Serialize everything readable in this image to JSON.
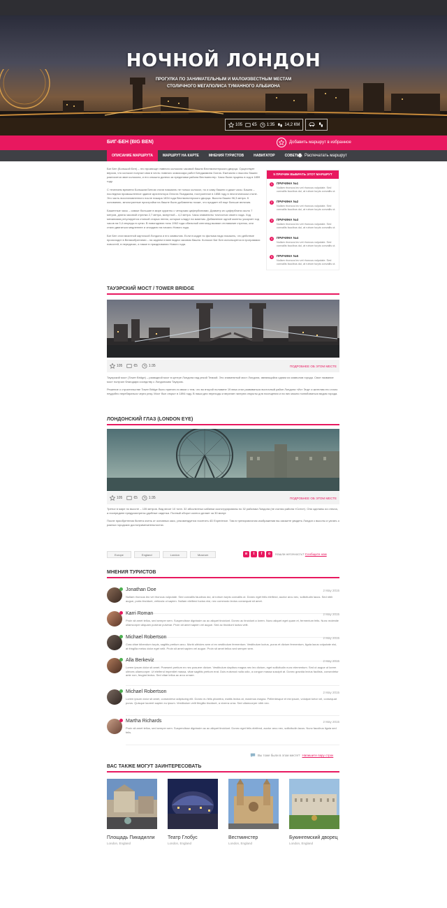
{
  "hero": {
    "title": "НОЧНОЙ ЛОНДОН",
    "subtitle_line1": "ПРОГУЛКА ПО ЗАНИМАТЕЛЬНЫМ И МАЛОИЗВЕСТНЫМ МЕСТАМ",
    "subtitle_line2": "СТОЛИЧНОГО МЕГАПОЛИСА ТУМАННОГО АЛЬБИОНА",
    "stats": {
      "likes": "105",
      "price": "€5",
      "time": "1:35",
      "distance": "14,2 КМ"
    },
    "transport_icons": [
      "car-icon",
      "walk-icon"
    ]
  },
  "place": {
    "title": "БИГ-БЕН (BIG BEN)",
    "fav_label": "Добавить маршрут в избранное"
  },
  "nav": {
    "tabs": [
      "ОПИСАНИЕ МАРШРУТА",
      "МАРШРУТ НА КАРТЕ",
      "МНЕНИЯ ТУРИСТОВ",
      "НАВИГАТОР",
      "СОВЕТЫ"
    ],
    "active_tab": 0,
    "print_label": "Распечатать маршрут"
  },
  "main_text": {
    "p1": "Биг Бен (Большой Бен) – это прозвище главного колокола часовой башни Вестминстерского дворца. Существует версия, что колокол получил имя в честь главного комиссара работ Бенджамина Холла. Ежечасно с высоты башни разносится звон колокола, и его слышно далеко за пределами района Вестминстер. Часы были пущены в ход в 1859 году.",
    "p2": "С течением времени Большим Беном стали называть не только колокол, но и саму башню и даже часы. Башня – последняя промышленное здание архитектора Огюста Пьюджина, построенное в 1858 году в неоготическом стиле. Это часть восстановленного после пожара 1834 года Вестминстерского дворца. Высота башни 96,3 метра. К основанию, многогранные пристройки на башне были добавлены позже, что придает ей еще больше величия.",
    "p3": "Башенные часы – самые большие в мире куранты с четырьмя циферблатами. Диаметр их циферблата около 7 метров, длина часовой стрелки 2,7 метра, минутной – 4,2 метра. Часы знамениты точностью своего хода. Ход механизма регулируется стопкой старых пенни, которые кладут на маятник. Добавление одной монеты ускоряет ход часов на 0,4 секунды в сутки. В новогоднюю ночь 1962 года обильный снегопад вызвал отставание стрелок, они стали двигаться медленнее и опоздали на начало Нового года.",
    "p4": "Биг Бен стал визитной карточкой Лондона и его символом. Если в кадре по фильма надо показать, что действие происходит в Великобритании – на заднем плане видна часовая башня. Колокол Биг Бен используется в программах новостей, в передачах, а также в праздновании Нового года."
  },
  "reasons": {
    "heading": "5 ПРИЧИН ВЫБРАТЬ ЭТОТ МАРШРУТ",
    "items": [
      {
        "num": "1",
        "title": "ПРИЧИНА №1",
        "text": "Nullam rhoncus leo vel rhoncus vulputate. Sed convallis faucibus dui, at rutrum turpis convallis ut."
      },
      {
        "num": "2",
        "title": "ПРИЧИНА №2",
        "text": "Nullam rhoncus leo vel rhoncus vulputate. Sed convallis faucibus dui, at rutrum turpis convallis ut."
      },
      {
        "num": "3",
        "title": "ПРИЧИНА №3",
        "text": "Nullam rhoncus leo vel rhoncus vulputate. Sed convallis faucibus dui, at rutrum turpis convallis ut."
      },
      {
        "num": "4",
        "title": "ПРИЧИНА №4",
        "text": "Nullam rhoncus leo vel rhoncus vulputate. Sed convallis faucibus dui, at rutrum turpis convallis ut."
      },
      {
        "num": "5",
        "title": "ПРИЧИНА №5",
        "text": "Nullam rhoncus leo vel rhoncus vulputate. Sed convallis faucibus dui, at rutrum turpis convallis ut."
      }
    ]
  },
  "tower_bridge": {
    "title": "ТАУЭРСКИЙ МОСТ / TOWER BRIDGE",
    "likes": "105",
    "price": "€5",
    "time": "1:35",
    "more_label": "ПОДРОБНЕЕ ОБ ЭТОМ МЕСТЕ",
    "p1": "Тауэрский мост (Tower Bridge) – разводной мост в центре Лондона над рекой Темзой. Это знаменитый мост Лондона, являющийся одним из символов города. Свое название мост получил благодаря соседству с Лондонским Тауэром.",
    "p2": "Решение о строительстве Tower Bridge было принято в связи с тем, что во второй половине 19 века стал развиваться восточный район Лондона «Ист Энд» и жителям его стало неудобно перебираться через реку. Мост был открыт в 1894 году. В наши дни переходы и верхние галереи открыты для посещения и на них можно полюбоваться видом города."
  },
  "london_eye": {
    "title": "ЛОНДОНСКИЙ ГЛАЗ (LONDON EYE)",
    "likes": "105",
    "price": "€5",
    "time": "1:35",
    "more_label": "ПОДРОБНЕЕ ОБ ЭТОМ МЕСТЕ",
    "p1": "Третье в мире по высоте – 135 метров. Вид весит 10 тонн. 32 абсолютных кабинки сконструированы по 32 районам Лондона (не считая района «Сити»). Они сделаны из стекла, а посередине предусмотрены удобные сиденья. Полный оборот колесо делает за 30 минут.",
    "p2": "После приобретения билета очень от основных касс, рекомендуется посетить 4D Experience. Там в тренировочном изображении вы сможете увидеть Лондон с высоты и узнать о разных городских достопримечательностях."
  },
  "tags": [
    "Europe",
    "England",
    "London",
    "Museum"
  ],
  "share_icons": [
    "vk-icon",
    "twitter-icon",
    "facebook-icon",
    "odnoklassniki-icon"
  ],
  "report": {
    "text": "Нашли неточность?",
    "link": "Сообщите нам"
  },
  "comments": {
    "title": "МНЕНИЯ ТУРИСТОВ",
    "items": [
      {
        "name": "Jonathan Doe",
        "date": "2 May 2015",
        "text": "Nullam rhoncus leo vel rhoncus vulputate. Sed convallis faucibus dui, at rutrum turpis convallis ut. Donec eget felis eleifend, auctor arcu nec, sollicitudin lacus. Sed nibh augue, porta tincidunt, vehicula ut sapien. Nullam eleifend luctus nisi, nec commodo lectus consequat sit amet."
      },
      {
        "name": "Karri Roman",
        "date": "2 May 2015",
        "text": "Proin sit amet tellus, sed semper sem. Suspendisse dignissim ac ac aliquet tincidunt. Donec ac tincidunt a lorem. Nunc aliquet eget quam et, fermentum felis. Nunc molestie ullamcorper aliquam pulvinar pulvinar. Proin sit amet sapien vel augue. Sed ac tincidunt luctus velit."
      },
      {
        "name": "Michael Robertson",
        "date": "2 May 2015",
        "text": "Cras vitae bibendum turpis, sagittis pretium arcu. Morbi ultricies sem ut ex vestibulum fermentum. Vestibulum luctus, purus et dictum fermentum, ligula lacus vulputate nisi, at fringilla metus dolor eget velit. Proin sit amet sapien vel augue. Proin sit amet tellus sed semper sem."
      },
      {
        "name": "Alla Berkeviz",
        "date": "2 May 2015",
        "text": "Lorem ipsum dolor sit amet. Praesent pretium ex nec posuere dictum. Vestibulum dapibus magna nec leo dictum, eget sollicitudin nunc elementum. Sed ut augue ut lorem ultrices ullamcorper. Ut eleifend imperdiet massa, vitae sagittis pretium erat. Duis euismod nulla odio, a congue massa suscipit at. Donec gravida lectus facilisis, consectetur ante non, feugiat lectus. Sed vitae tellus ac arcu ornare."
      },
      {
        "name": "Michael Robertson",
        "date": "2 May 2015",
        "text": "Lorem ipsum dolor sit amet, consectetur adipiscing elit. Donec eu felis pharetra, mattis lectus at, maximus magna. Pellentesque et est ipsum, volutpat tortor vel, consequat purus. Quisque laoreet sapien eu ipsum. Vestibulum velit fringilla tincidunt, a viverra urna. Sed ullamcorper nibh nec."
      },
      {
        "name": "Martha Richards",
        "date": "2 May 2015",
        "text": "Proin sit amet tellus, sed semper sem. Suspendisse dignissim ac ac aliquet tincidunt. Donec eget felis eleifend, auctor arcu nec, sollicitudin lacus. Nunc faucibus ligula sed felis."
      }
    ]
  },
  "ask": {
    "text": "Вы тоже были в этом месте?",
    "link": "Напишите пару строк"
  },
  "related": {
    "title": "ВАС ТАКЖЕ МОГУТ ЗАИНТЕРЕСОВАТЬ",
    "items": [
      {
        "title": "Площадь Пикадилли",
        "sub": "London, England"
      },
      {
        "title": "Театр Глобус",
        "sub": "London, England"
      },
      {
        "title": "Вестминстер",
        "sub": "London, England"
      },
      {
        "title": "Букингемский дворец",
        "sub": "London, England"
      }
    ]
  },
  "colors": {
    "accent": "#e8185f",
    "nav": "#3f4045",
    "topbar": "#2e2e33"
  }
}
